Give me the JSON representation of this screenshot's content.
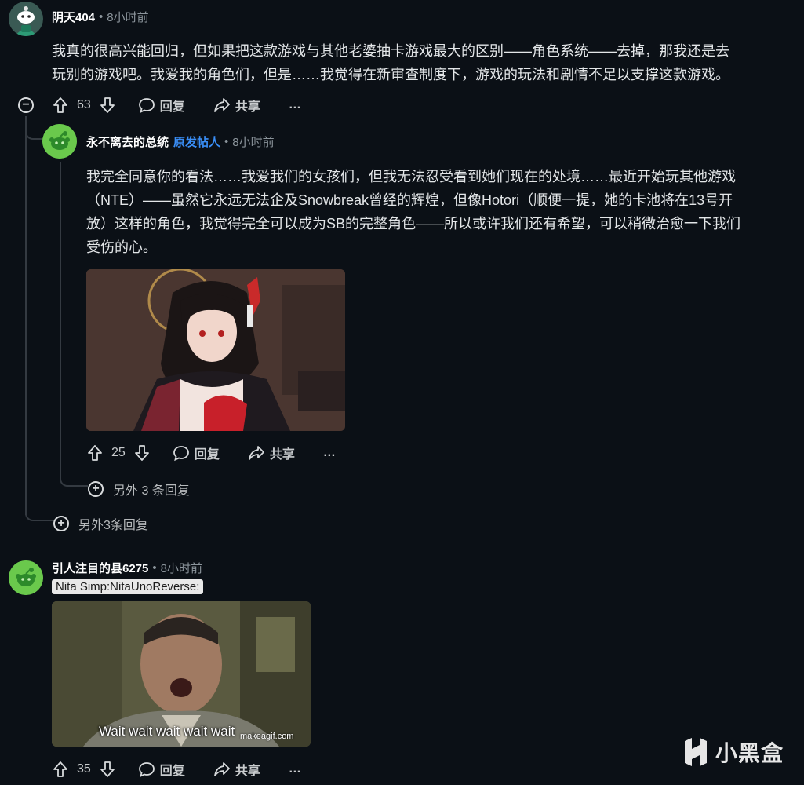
{
  "comments": [
    {
      "username": "阴天404",
      "time": "8小时前",
      "text_line1": "我真的很高兴能回归，但如果把这款游戏与其他老婆抽卡游戏最大的区别——角色系统——去掉，那我还是去",
      "text_line2": "玩别的游戏吧。我爱我的角色们，但是……我觉得在新审查制度下，游戏的玩法和剧情不足以支撑这款游戏。",
      "upvotes": "63",
      "reply_label": "回复",
      "share_label": "共享",
      "more_label": "…",
      "more_replies": "另外3条回复"
    },
    {
      "username": "永不离去的总统",
      "op_tag": "原发帖人",
      "time": "8小时前",
      "text_line1": "我完全同意你的看法……我爱我们的女孩们，但我无法忍受看到她们现在的处境……最近开始玩其他游戏",
      "text_line2": "（NTE）——虽然它永远无法企及Snowbreak曾经的辉煌，但像Hotori（顺便一提，她的卡池将在13号开",
      "text_line3": "放）这样的角色，我觉得完全可以成为SB的完整角色——所以或许我们还有希望，可以稍微治愈一下我们",
      "text_line4": "受伤的心。",
      "upvotes": "25",
      "reply_label": "回复",
      "share_label": "共享",
      "more_label": "…",
      "more_replies": "另外 3 条回复"
    },
    {
      "username": "引人注目的县6275",
      "time": "8小时前",
      "flair": "Nita Simp:NitaUnoReverse:",
      "gif_caption": "Wait wait wait wait wait",
      "gif_watermark": "makeagif.com",
      "upvotes": "35",
      "reply_label": "回复",
      "share_label": "共享",
      "more_label": "…"
    }
  ],
  "watermark": "小黑盒",
  "icons": [
    "upvote-icon",
    "downvote-icon",
    "comment-icon",
    "share-icon",
    "collapse-icon",
    "expand-icon"
  ]
}
